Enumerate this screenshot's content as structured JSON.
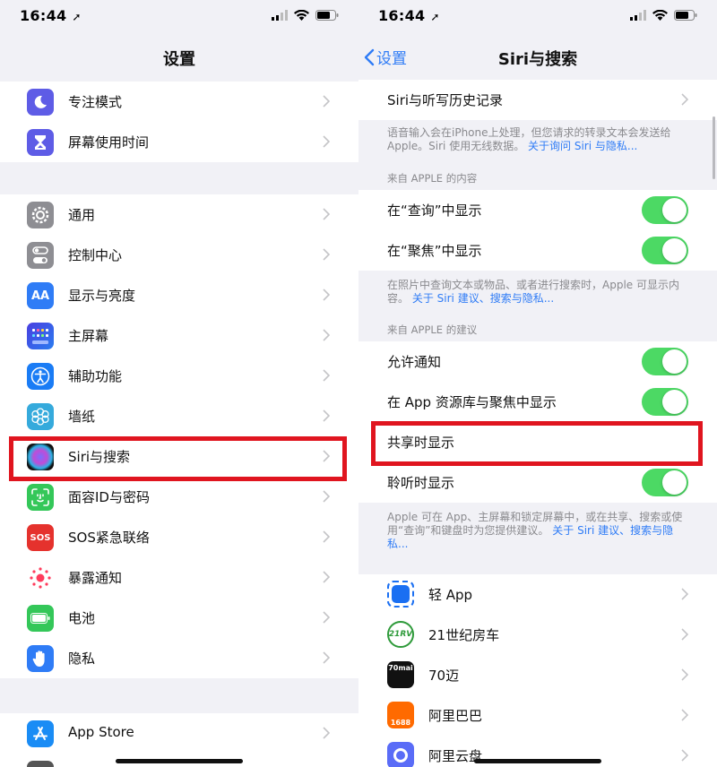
{
  "status": {
    "time": "16:44"
  },
  "left": {
    "title": "设置",
    "group1": [
      {
        "label": "专注模式",
        "icon": "moon-icon",
        "color": "#5e5ce6"
      },
      {
        "label": "屏幕使用时间",
        "icon": "hourglass-icon",
        "color": "#5e5ce6"
      }
    ],
    "group2": [
      {
        "label": "通用",
        "icon": "gear-icon",
        "color": "#8e8e93"
      },
      {
        "label": "控制中心",
        "icon": "toggles-icon",
        "color": "#8e8e93"
      },
      {
        "label": "显示与亮度",
        "icon": "text-size-icon",
        "color": "#2f7cf6",
        "glyph": "AA"
      },
      {
        "label": "主屏幕",
        "icon": "home-grid-icon",
        "color": "#3b4fd9"
      },
      {
        "label": "辅助功能",
        "icon": "accessibility-icon",
        "color": "#1a7cf5"
      },
      {
        "label": "墙纸",
        "icon": "flower-icon",
        "color": "#35aadc"
      },
      {
        "label": "Siri与搜索",
        "icon": "siri-icon",
        "color": "#222"
      },
      {
        "label": "面容ID与密码",
        "icon": "faceid-icon",
        "color": "#34c759"
      },
      {
        "label": "SOS紧急联络",
        "icon": "sos-icon",
        "color": "#e5322d",
        "glyph": "SOS"
      },
      {
        "label": "暴露通知",
        "icon": "exposure-icon",
        "color": "#ffffff"
      },
      {
        "label": "电池",
        "icon": "battery-icon",
        "color": "#34c759"
      },
      {
        "label": "隐私",
        "icon": "hand-icon",
        "color": "#2f7cf6"
      }
    ],
    "group3": [
      {
        "label": "App Store",
        "icon": "app-store-icon",
        "color": "#1a8cf5"
      }
    ]
  },
  "right": {
    "back_label": "设置",
    "title": "Siri与搜索",
    "history": "Siri与听写历史记录",
    "note1": "语音输入会在iPhone上处理，但您请求的转录文本会发送给Apple。Siri 使用无线数据。",
    "note1_link": "关于询问 Siri 与隐私...",
    "section1": "来自 APPLE 的内容",
    "show_in_lookup": "在“查询”中显示",
    "show_in_spotlight": "在“聚焦”中显示",
    "note2": "在照片中查询文本或物品、或者进行搜索时，Apple 可显示内容。",
    "note2_link": "关于 Siri 建议、搜索与隐私...",
    "section2": "来自 APPLE 的建议",
    "allow_notifications": "允许通知",
    "show_in_library": "在 App 资源库与聚焦中显示",
    "show_when_sharing": "共享时显示",
    "show_when_listening": "聆听时显示",
    "note3": "Apple 可在 App、主屏幕和锁定屏幕中，或在共享、搜索或使用“查询”和键盘时为您提供建议。",
    "note3_link": "关于 Siri 建议、搜索与隐私...",
    "apps": [
      {
        "label": "轻 App",
        "icon": "light-app-icon",
        "color": "#1a6ff2"
      },
      {
        "label": "21世纪房车",
        "icon": "rv21-logo-icon",
        "color": "#2e9a3a",
        "glyph": "21RV"
      },
      {
        "label": "70迈",
        "icon": "70mai-icon",
        "color": "#111111",
        "glyph": "70mai"
      },
      {
        "label": "阿里巴巴",
        "icon": "alibaba-icon",
        "color": "#ff6a00",
        "glyph": "1688"
      },
      {
        "label": "阿里云盘",
        "icon": "aliyun-drive-icon",
        "color": "#5a6cf7"
      }
    ]
  },
  "colors": {
    "accent": "#2f7cf6",
    "toggle_on": "#4cd964",
    "highlight": "#e0151f"
  }
}
